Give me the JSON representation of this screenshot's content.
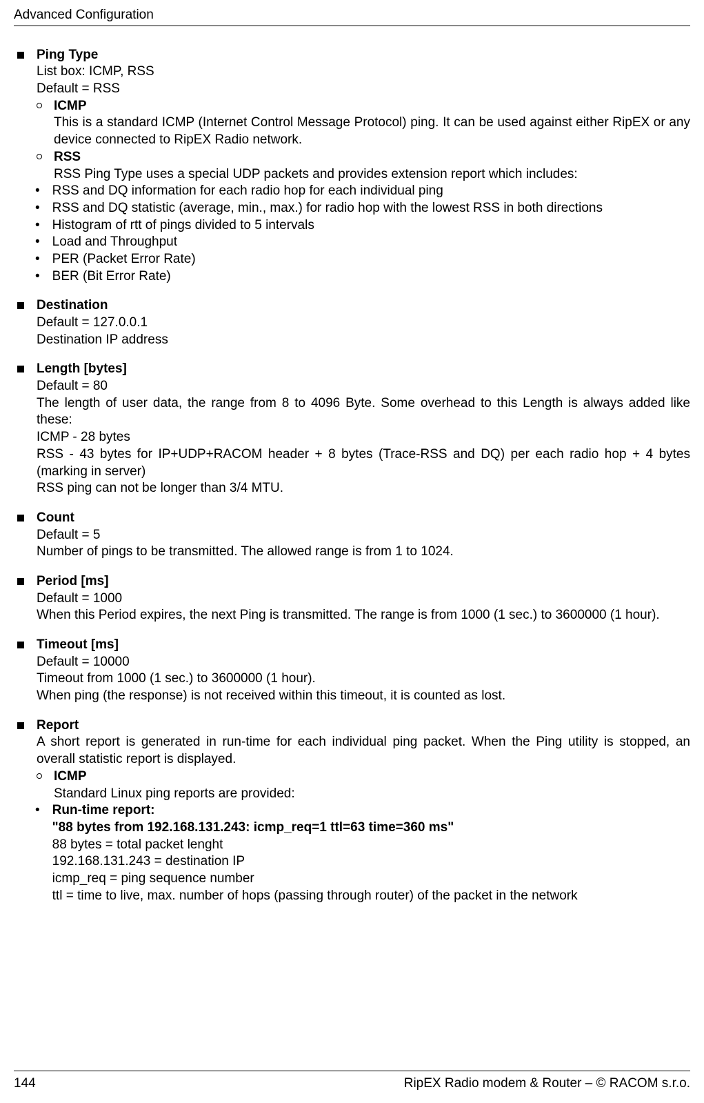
{
  "header": "Advanced Configuration",
  "footer": {
    "left": "144",
    "right": "RipEX Radio modem & Router – © RACOM s.r.o."
  },
  "sections": {
    "ping_type": {
      "title": "Ping Type",
      "line1": "List box: ICMP, RSS",
      "line2": "Default = RSS",
      "icmp": {
        "title": "ICMP",
        "desc": "This is a standard ICMP (Internet Control Message Protocol) ping. It can be used against either RipEX or any device connected to RipEX Radio network."
      },
      "rss": {
        "title": "RSS",
        "desc": "RSS Ping Type uses a special UDP packets and provides extension report which includes:",
        "b1": "RSS and DQ information for each radio hop for each individual ping",
        "b2": "RSS and DQ statistic (average, min., max.) for radio hop with the lowest RSS in both directions",
        "b3": "Histogram of rtt of pings divided to 5 intervals",
        "b4": "Load and Throughput",
        "b5": "PER (Packet Error Rate)",
        "b6": "BER (Bit Error Rate)"
      }
    },
    "destination": {
      "title": "Destination",
      "l1": "Default = 127.0.0.1",
      "l2": "Destination IP address"
    },
    "length": {
      "title": "Length [bytes]",
      "l1": "Default = 80",
      "l2": "The length of user data, the range from 8 to 4096 Byte. Some overhead to this Length is always added like these:",
      "l3": "ICMP - 28 bytes",
      "l4": "RSS - 43 bytes for IP+UDP+RACOM header + 8 bytes (Trace-RSS and DQ) per each radio hop + 4 bytes (marking in server)",
      "l5": "RSS ping can not be longer than 3/4 MTU."
    },
    "count": {
      "title": "Count",
      "l1": "Default = 5",
      "l2": "Number of pings to be transmitted. The allowed range is from 1 to 1024."
    },
    "period": {
      "title": "Period [ms]",
      "l1": "Default = 1000",
      "l2": "When this Period expires, the next Ping is transmitted. The range is from 1000 (1 sec.) to 3600000 (1 hour)."
    },
    "timeout": {
      "title": "Timeout [ms]",
      "l1": "Default = 10000",
      "l2": "Timeout from 1000 (1 sec.) to 3600000 (1 hour).",
      "l3": "When ping (the response) is not received within this timeout, it is counted as lost."
    },
    "report": {
      "title": "Report",
      "desc": "A short report is generated in run-time for each individual ping packet. When the Ping utility is stopped, an overall statistic report is displayed.",
      "icmp": {
        "title": "ICMP",
        "desc": "Standard Linux ping reports are provided:",
        "rt": {
          "title": "Run-time report:",
          "ex": "\"88 bytes from 192.168.131.243: icmp_req=1 ttl=63 time=360 ms\"",
          "l1": "88 bytes = total packet lenght",
          "l2": "192.168.131.243 = destination IP",
          "l3": "icmp_req = ping sequence number",
          "l4": "ttl = time to live, max. number of hops (passing through router) of the packet in the network"
        }
      }
    }
  }
}
